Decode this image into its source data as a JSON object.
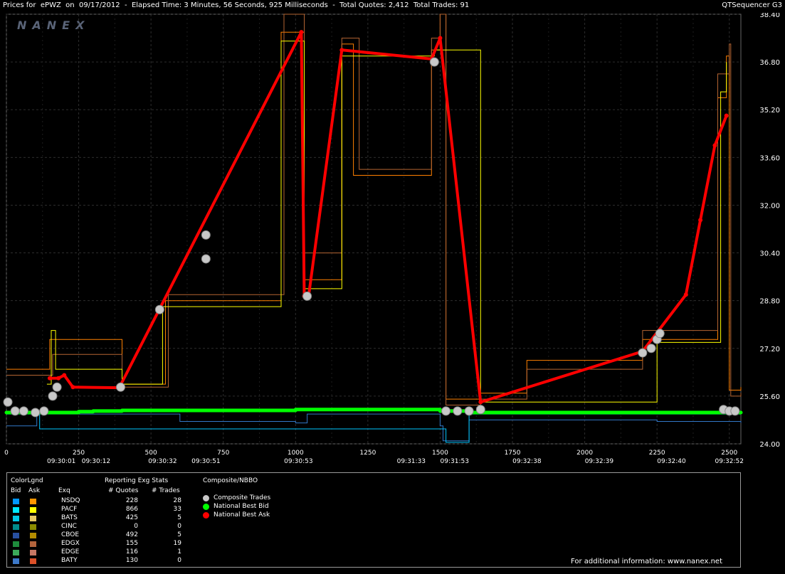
{
  "header": {
    "title": "Prices for  ePWZ  on  09/17/2012  -  Elapsed Time: 3 Minutes, 56 Seconds, 925 Milliseconds  -  Total Quotes: 2,412  Total Trades: 91",
    "app_name": "QTSequencer G3"
  },
  "watermark": "NANEX",
  "colors": {
    "background": "#000000",
    "grid": "#2d2d2d",
    "best_bid": "#00ff00",
    "best_ask": "#ff0000",
    "composite_trade": "#c8c8c8"
  },
  "chart_data": {
    "type": "line",
    "ylim": [
      24.0,
      38.4
    ],
    "y_ticks": [
      "38.40",
      "36.80",
      "35.20",
      "33.60",
      "32.00",
      "30.40",
      "28.80",
      "27.20",
      "25.60",
      "24.00"
    ],
    "xlim": [
      0,
      2540
    ],
    "x_ticks": [
      "0",
      "250",
      "500",
      "750",
      "1000",
      "1250",
      "1500",
      "1750",
      "2000",
      "2250",
      "2500"
    ],
    "time_labels": [
      {
        "x": 190,
        "label": "09:30:01"
      },
      {
        "x": 310,
        "label": "09:30:12"
      },
      {
        "x": 540,
        "label": "09:30:32"
      },
      {
        "x": 690,
        "label": "09:30:51"
      },
      {
        "x": 1010,
        "label": "09:30:53"
      },
      {
        "x": 1400,
        "label": "09:31:33"
      },
      {
        "x": 1550,
        "label": "09:31:53"
      },
      {
        "x": 1800,
        "label": "09:32:38"
      },
      {
        "x": 2050,
        "label": "09:32:39"
      },
      {
        "x": 2300,
        "label": "09:32:40"
      },
      {
        "x": 2500,
        "label": "09:32:52"
      }
    ],
    "series": [
      {
        "name": "National Best Bid",
        "color": "#00ff00",
        "points": [
          [
            0,
            25.05
          ],
          [
            150,
            25.05
          ],
          [
            250,
            25.08
          ],
          [
            300,
            25.1
          ],
          [
            400,
            25.12
          ],
          [
            1000,
            25.15
          ],
          [
            1500,
            25.1
          ],
          [
            1600,
            25.05
          ],
          [
            2000,
            25.05
          ],
          [
            2540,
            25.05
          ]
        ]
      },
      {
        "name": "National Best Ask",
        "color": "#ff0000",
        "points": [
          [
            150,
            26.2
          ],
          [
            180,
            26.2
          ],
          [
            200,
            26.3
          ],
          [
            230,
            25.9
          ],
          [
            390,
            25.88
          ],
          [
            1020,
            37.8
          ],
          [
            1030,
            28.95
          ],
          [
            1045,
            28.95
          ],
          [
            1160,
            37.2
          ],
          [
            1470,
            36.9
          ],
          [
            1500,
            37.6
          ],
          [
            1640,
            25.4
          ],
          [
            2200,
            27.1
          ],
          [
            2350,
            29.0
          ],
          [
            2400,
            31.5
          ],
          [
            2450,
            34.0
          ],
          [
            2490,
            35.0
          ]
        ]
      }
    ],
    "exchange_quote_series": [
      {
        "name": "NSDQ",
        "color": "#ff8000",
        "points": [
          [
            0,
            26.5
          ],
          [
            140,
            26.5
          ],
          [
            150,
            27.5
          ],
          [
            400,
            26.0
          ],
          [
            550,
            28.8
          ],
          [
            950,
            37.8
          ],
          [
            1030,
            29.5
          ],
          [
            1160,
            37.4
          ],
          [
            1200,
            33.0
          ],
          [
            1470,
            37.2
          ],
          [
            1500,
            38.4
          ],
          [
            1520,
            25.5
          ],
          [
            1640,
            25.7
          ],
          [
            1800,
            26.8
          ],
          [
            2200,
            27.5
          ],
          [
            2460,
            35.6
          ],
          [
            2490,
            37.0
          ],
          [
            2500,
            25.8
          ],
          [
            2540,
            25.9
          ]
        ]
      },
      {
        "name": "EDGX",
        "color": "#b46432",
        "points": [
          [
            0,
            26.3
          ],
          [
            140,
            26.3
          ],
          [
            160,
            27.0
          ],
          [
            400,
            25.9
          ],
          [
            560,
            29.0
          ],
          [
            960,
            38.4
          ],
          [
            1030,
            30.4
          ],
          [
            1160,
            37.6
          ],
          [
            1220,
            33.2
          ],
          [
            1470,
            37.6
          ],
          [
            1500,
            38.4
          ],
          [
            1520,
            25.3
          ],
          [
            1640,
            25.5
          ],
          [
            1800,
            26.5
          ],
          [
            2200,
            27.8
          ],
          [
            2460,
            36.4
          ],
          [
            2500,
            37.4
          ],
          [
            2505,
            25.6
          ],
          [
            2540,
            25.7
          ]
        ]
      },
      {
        "name": "PACF",
        "color": "#ffff00",
        "points": [
          [
            140,
            26.0
          ],
          [
            155,
            27.8
          ],
          [
            170,
            26.5
          ],
          [
            400,
            26.0
          ],
          [
            540,
            28.6
          ],
          [
            950,
            37.5
          ],
          [
            1030,
            29.2
          ],
          [
            1160,
            37.0
          ],
          [
            1480,
            37.2
          ],
          [
            1640,
            25.4
          ],
          [
            2250,
            27.4
          ],
          [
            2470,
            35.8
          ],
          [
            2490,
            36.8
          ]
        ]
      }
    ],
    "exchange_bid_series": [
      {
        "name": "BATY",
        "color": "#3278c8",
        "points": [
          [
            0,
            24.6
          ],
          [
            100,
            24.6
          ],
          [
            105,
            25.0
          ],
          [
            600,
            24.75
          ],
          [
            1000,
            24.7
          ],
          [
            1040,
            25.0
          ],
          [
            1500,
            24.6
          ],
          [
            1510,
            24.1
          ],
          [
            1600,
            24.8
          ],
          [
            2250,
            24.75
          ],
          [
            2540,
            24.7
          ]
        ]
      },
      {
        "name": "BATS",
        "color": "#00c8ff",
        "points": [
          [
            0,
            25.0
          ],
          [
            110,
            25.0
          ],
          [
            115,
            24.5
          ],
          [
            1500,
            24.5
          ],
          [
            1520,
            24.05
          ],
          [
            1600,
            25.0
          ],
          [
            2540,
            25.0
          ]
        ]
      }
    ],
    "composite_trades": [
      [
        5,
        25.4
      ],
      [
        30,
        25.1
      ],
      [
        60,
        25.1
      ],
      [
        100,
        25.05
      ],
      [
        130,
        25.1
      ],
      [
        160,
        25.6
      ],
      [
        175,
        25.9
      ],
      [
        395,
        25.9
      ],
      [
        530,
        28.5
      ],
      [
        690,
        31.0
      ],
      [
        690,
        30.2
      ],
      [
        1040,
        28.95
      ],
      [
        1480,
        36.8
      ],
      [
        1520,
        25.1
      ],
      [
        1560,
        25.1
      ],
      [
        1600,
        25.1
      ],
      [
        1640,
        25.15
      ],
      [
        2200,
        27.05
      ],
      [
        2230,
        27.2
      ],
      [
        2250,
        27.5
      ],
      [
        2260,
        27.7
      ],
      [
        2480,
        25.15
      ],
      [
        2500,
        25.1
      ],
      [
        2520,
        25.1
      ]
    ]
  },
  "legend": {
    "color_heading": "ColorLgnd",
    "bid_label": "Bid",
    "ask_label": "Ask",
    "exg_heading": "Exq",
    "stats_heading": "Reporting Exg Stats",
    "quotes_heading": "# Quotes",
    "trades_heading": "# Trades",
    "composite_heading": "Composite/NBBO",
    "exchanges": [
      {
        "name": "NSDQ",
        "bid_color": "#0096ff",
        "ask_color": "#ff9600",
        "quotes": "228",
        "trades": "28"
      },
      {
        "name": "PACF",
        "bid_color": "#00e6ff",
        "ask_color": "#ffff00",
        "quotes": "866",
        "trades": "33"
      },
      {
        "name": "BATS",
        "bid_color": "#00c8e6",
        "ask_color": "#e6c864",
        "quotes": "425",
        "trades": "5"
      },
      {
        "name": "CINC",
        "bid_color": "#008c8c",
        "ask_color": "#8c8c00",
        "quotes": "0",
        "trades": "0"
      },
      {
        "name": "CBOE",
        "bid_color": "#2850a0",
        "ask_color": "#b48c00",
        "quotes": "492",
        "trades": "5"
      },
      {
        "name": "EDGX",
        "bid_color": "#1e8c3c",
        "ask_color": "#b4643c",
        "quotes": "155",
        "trades": "19"
      },
      {
        "name": "EDGE",
        "bid_color": "#3caa5a",
        "ask_color": "#c87864",
        "quotes": "116",
        "trades": "1"
      },
      {
        "name": "BATY",
        "bid_color": "#3c78c8",
        "ask_color": "#dc5028",
        "quotes": "130",
        "trades": "0"
      }
    ],
    "composite_items": [
      {
        "label": "Composite Trades",
        "color": "#c8c8c8"
      },
      {
        "label": "National Best Bid",
        "color": "#00ff00"
      },
      {
        "label": "National Best Ask",
        "color": "#ff0000"
      }
    ],
    "footer": "For additional information: www.nanex.net"
  }
}
